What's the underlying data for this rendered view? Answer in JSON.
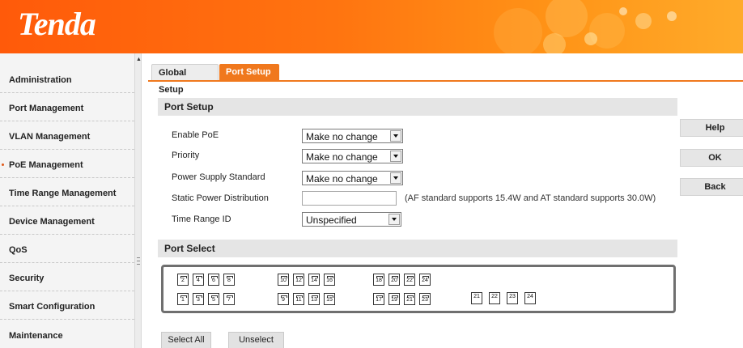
{
  "header": {
    "brand": "Tenda"
  },
  "sidebar": {
    "items": [
      {
        "label": "Administration"
      },
      {
        "label": "Port Management"
      },
      {
        "label": "VLAN Management"
      },
      {
        "label": "PoE Management",
        "active": true
      },
      {
        "label": "Time Range Management"
      },
      {
        "label": "Device Management"
      },
      {
        "label": "QoS"
      },
      {
        "label": "Security"
      },
      {
        "label": "Smart Configuration"
      },
      {
        "label": "Maintenance"
      }
    ]
  },
  "tabs": [
    {
      "label": "Global Setup",
      "active": false
    },
    {
      "label": "Port Setup",
      "active": true
    }
  ],
  "port_setup": {
    "section_title": "Port Setup",
    "enable_poe": {
      "label": "Enable PoE",
      "value": "Make no change"
    },
    "priority": {
      "label": "Priority",
      "value": "Make no change"
    },
    "power_supply_standard": {
      "label": "Power Supply Standard",
      "value": "Make no change"
    },
    "static_power": {
      "label": "Static Power Distribution",
      "value": "",
      "hint": "(AF standard supports 15.4W and AT standard supports 30.0W)"
    },
    "time_range_id": {
      "label": "Time Range ID",
      "value": "Unspecified"
    }
  },
  "port_select": {
    "section_title": "Port Select",
    "top_row": [
      "2",
      "4",
      "6",
      "8",
      "10",
      "12",
      "14",
      "16",
      "18",
      "20",
      "22",
      "24"
    ],
    "bottom_row": [
      "1",
      "3",
      "5",
      "7",
      "9",
      "11",
      "13",
      "15",
      "17",
      "19",
      "21",
      "23"
    ],
    "sfp_ports": [
      "21",
      "22",
      "23",
      "24"
    ]
  },
  "actions": {
    "help": "Help",
    "ok": "OK",
    "back": "Back"
  },
  "buttons": {
    "select_all": "Select All",
    "unselect": "Unselect"
  },
  "colors": {
    "accent": "#f0781d",
    "header_start": "#ff5a0a",
    "header_end": "#ffab2a"
  }
}
